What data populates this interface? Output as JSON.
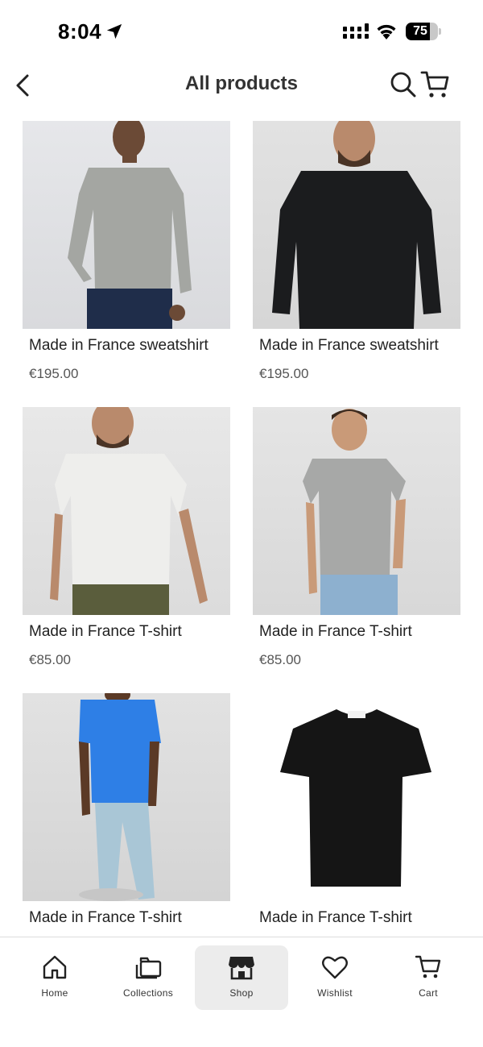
{
  "status_bar": {
    "time": "8:04",
    "battery": "75",
    "battery_level": 0.75
  },
  "header": {
    "title": "All products"
  },
  "products": [
    {
      "name": "Made in France sweatshirt",
      "price": "€195.00",
      "icon": "grey-sweatshirt-photo"
    },
    {
      "name": "Made in France sweatshirt",
      "price": "€195.00",
      "icon": "black-sweatshirt-photo"
    },
    {
      "name": "Made in France T-shirt",
      "price": "€85.00",
      "icon": "white-tshirt-photo"
    },
    {
      "name": "Made in France T-shirt",
      "price": "€85.00",
      "icon": "grey-tshirt-photo"
    },
    {
      "name": "Made in France T-shirt",
      "price": "",
      "icon": "blue-tshirt-photo"
    },
    {
      "name": "Made in France T-shirt",
      "price": "",
      "icon": "black-tshirt-photo"
    }
  ],
  "tabbar": {
    "items": [
      {
        "label": "Home",
        "icon": "home-icon"
      },
      {
        "label": "Collections",
        "icon": "collections-icon"
      },
      {
        "label": "Shop",
        "icon": "shop-icon",
        "active": true
      },
      {
        "label": "Wishlist",
        "icon": "heart-icon"
      },
      {
        "label": "Cart",
        "icon": "cart-icon"
      }
    ]
  },
  "colors": {
    "accent": "#1a1a1a",
    "active_tab_bg": "#ececec",
    "price": "#555555"
  }
}
